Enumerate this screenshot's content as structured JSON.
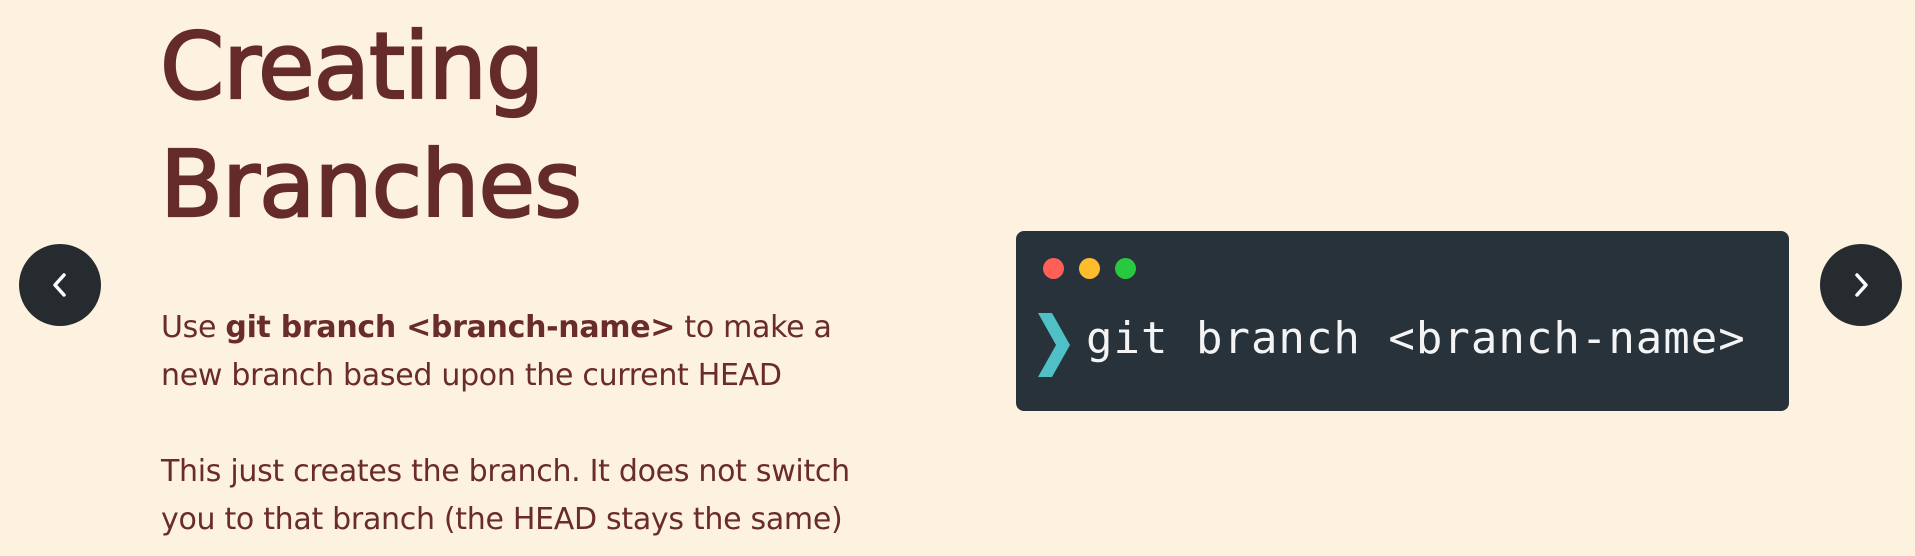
{
  "slide": {
    "title_line1": "Creating",
    "title_line2": "Branches",
    "para1": {
      "prefix": "Use ",
      "command": "git branch <branch-name>",
      "suffix_line1": " to make a",
      "line2": "new branch based upon the current HEAD"
    },
    "para2": {
      "line1": "This just creates the branch.  It does not switch",
      "line2": "you to that branch (the HEAD stays the same)"
    }
  },
  "terminal": {
    "command": "git branch <branch-name>",
    "dots": [
      "#ff5f56",
      "#ffbd2e",
      "#27c93f"
    ],
    "prompt_icon": "chevron-prompt-icon",
    "prompt_color": "#4fc0c6"
  },
  "navigation": {
    "prev_icon": "chevron-left-icon",
    "next_icon": "chevron-right-icon"
  },
  "colors": {
    "background": "#fdf1df",
    "text": "#6a2b2b",
    "terminal_bg": "#27323a",
    "nav_button": "#252b2e"
  }
}
